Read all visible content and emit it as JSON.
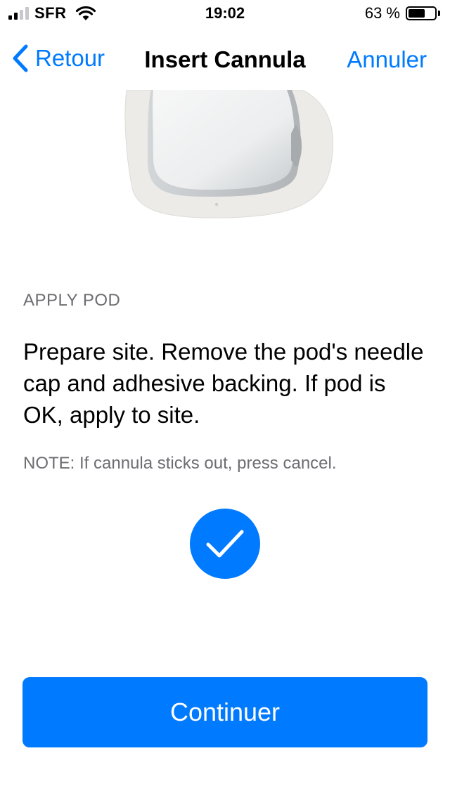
{
  "status_bar": {
    "carrier": "SFR",
    "time": "19:02",
    "battery_percent": "63 %",
    "battery_level": 0.63,
    "signal_bars": 4,
    "signal_active": 2
  },
  "nav": {
    "back_label": "Retour",
    "title": "Insert Cannula",
    "cancel_label": "Annuler"
  },
  "content": {
    "section_header": "APPLY POD",
    "instructions": "Prepare site. Remove the pod's needle cap and adhesive backing. If pod is OK, apply to site.",
    "note": "NOTE: If cannula sticks out, press cancel."
  },
  "actions": {
    "continue_label": "Continuer"
  },
  "colors": {
    "accent": "#007aff",
    "secondary_text": "#6d6d72"
  }
}
